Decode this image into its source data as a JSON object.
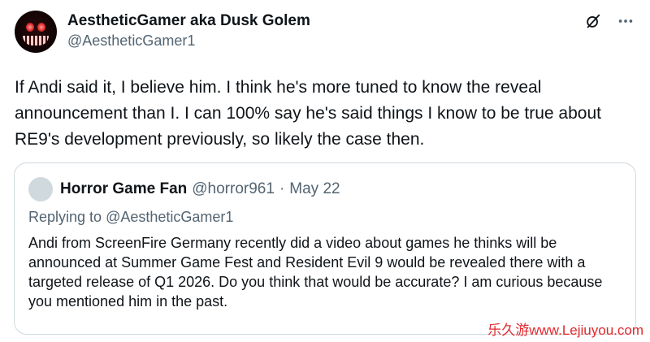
{
  "author": {
    "display_name": "AestheticGamer aka Dusk Golem",
    "handle": "@AestheticGamer1"
  },
  "icons": {
    "top_right": [
      "grok-slash-icon",
      "more-icon"
    ]
  },
  "tweet": {
    "text": "If Andi said it, I believe him. I think he's more tuned to know the reveal announcement than I. I can 100% say he's said things I know to be true about RE9's development previously, so likely the case then."
  },
  "quoted": {
    "display_name": "Horror Game Fan",
    "handle": "@horror961",
    "separator": "·",
    "date": "May 22",
    "replying_prefix": "Replying to ",
    "replying_to": "@AestheticGamer1",
    "text": "Andi from ScreenFire Germany recently did a video about games he thinks will be announced at Summer Game Fest and  Resident Evil 9 would be revealed there with a targeted release of Q1 2026. Do you think that would be accurate? I am curious because you mentioned him in the past."
  },
  "watermark": "乐久游www.Lejiuyou.com",
  "colors": {
    "text": "#0f1419",
    "secondary": "#536471",
    "border": "#cfd9de",
    "watermark": "#e0282e"
  }
}
